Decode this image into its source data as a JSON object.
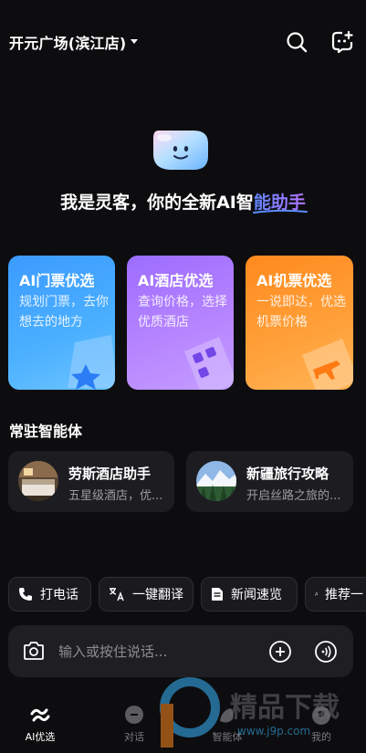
{
  "header": {
    "location": "开元广场(滨江店)",
    "icons": [
      "chevron-down-icon",
      "search-icon",
      "new-chat-icon"
    ]
  },
  "hero": {
    "greeting_prefix": "我是灵客，你的全新AI智",
    "greeting_highlight": "能助手"
  },
  "cards": [
    {
      "title": "AI门票优选",
      "desc": "规划门票，去你想去的地方",
      "color": "#3c9bff"
    },
    {
      "title": "AI酒店优选",
      "desc": "查询价格，选择优质酒店",
      "color": "#9c6cff"
    },
    {
      "title": "AI机票优选",
      "desc": "一说即达，优选机票价格",
      "color": "#ff8a1f"
    }
  ],
  "resident": {
    "title": "常驻智能体",
    "agents": [
      {
        "name": "劳斯酒店助手",
        "sub": "五星级酒店，优..."
      },
      {
        "name": "新疆旅行攻略",
        "sub": "开启丝路之旅的..."
      }
    ]
  },
  "quick_actions": [
    {
      "label": "打电话",
      "icon": "phone-icon"
    },
    {
      "label": "一键翻译",
      "icon": "translate-icon"
    },
    {
      "label": "新闻速览",
      "icon": "news-icon"
    },
    {
      "label": "推荐一",
      "icon": "music-icon"
    }
  ],
  "input": {
    "placeholder": "输入或按住说话..."
  },
  "tabs": [
    {
      "label": "AI优选",
      "active": true
    },
    {
      "label": "对话",
      "active": false
    },
    {
      "label": "智能体",
      "active": false
    },
    {
      "label": "我的",
      "active": false
    }
  ],
  "watermark": {
    "text": "精品下载",
    "url": "www.j9p.com"
  }
}
